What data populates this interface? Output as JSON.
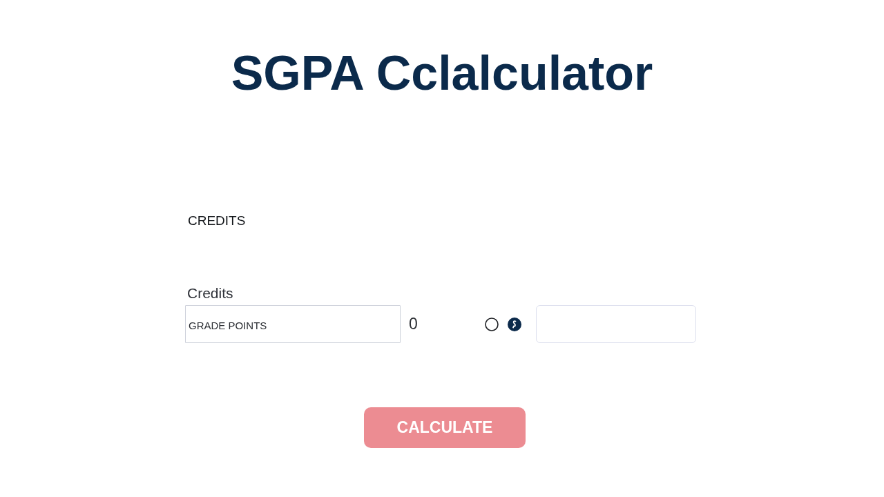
{
  "title": "SGPA Cclalculator",
  "section_heading": "CREDITS",
  "credits_field": {
    "label": "Credits",
    "value": "GRADE POINTS"
  },
  "total": "0",
  "options": [
    {
      "selected": false
    },
    {
      "selected": true
    }
  ],
  "button": {
    "label": "CALCULATE"
  }
}
